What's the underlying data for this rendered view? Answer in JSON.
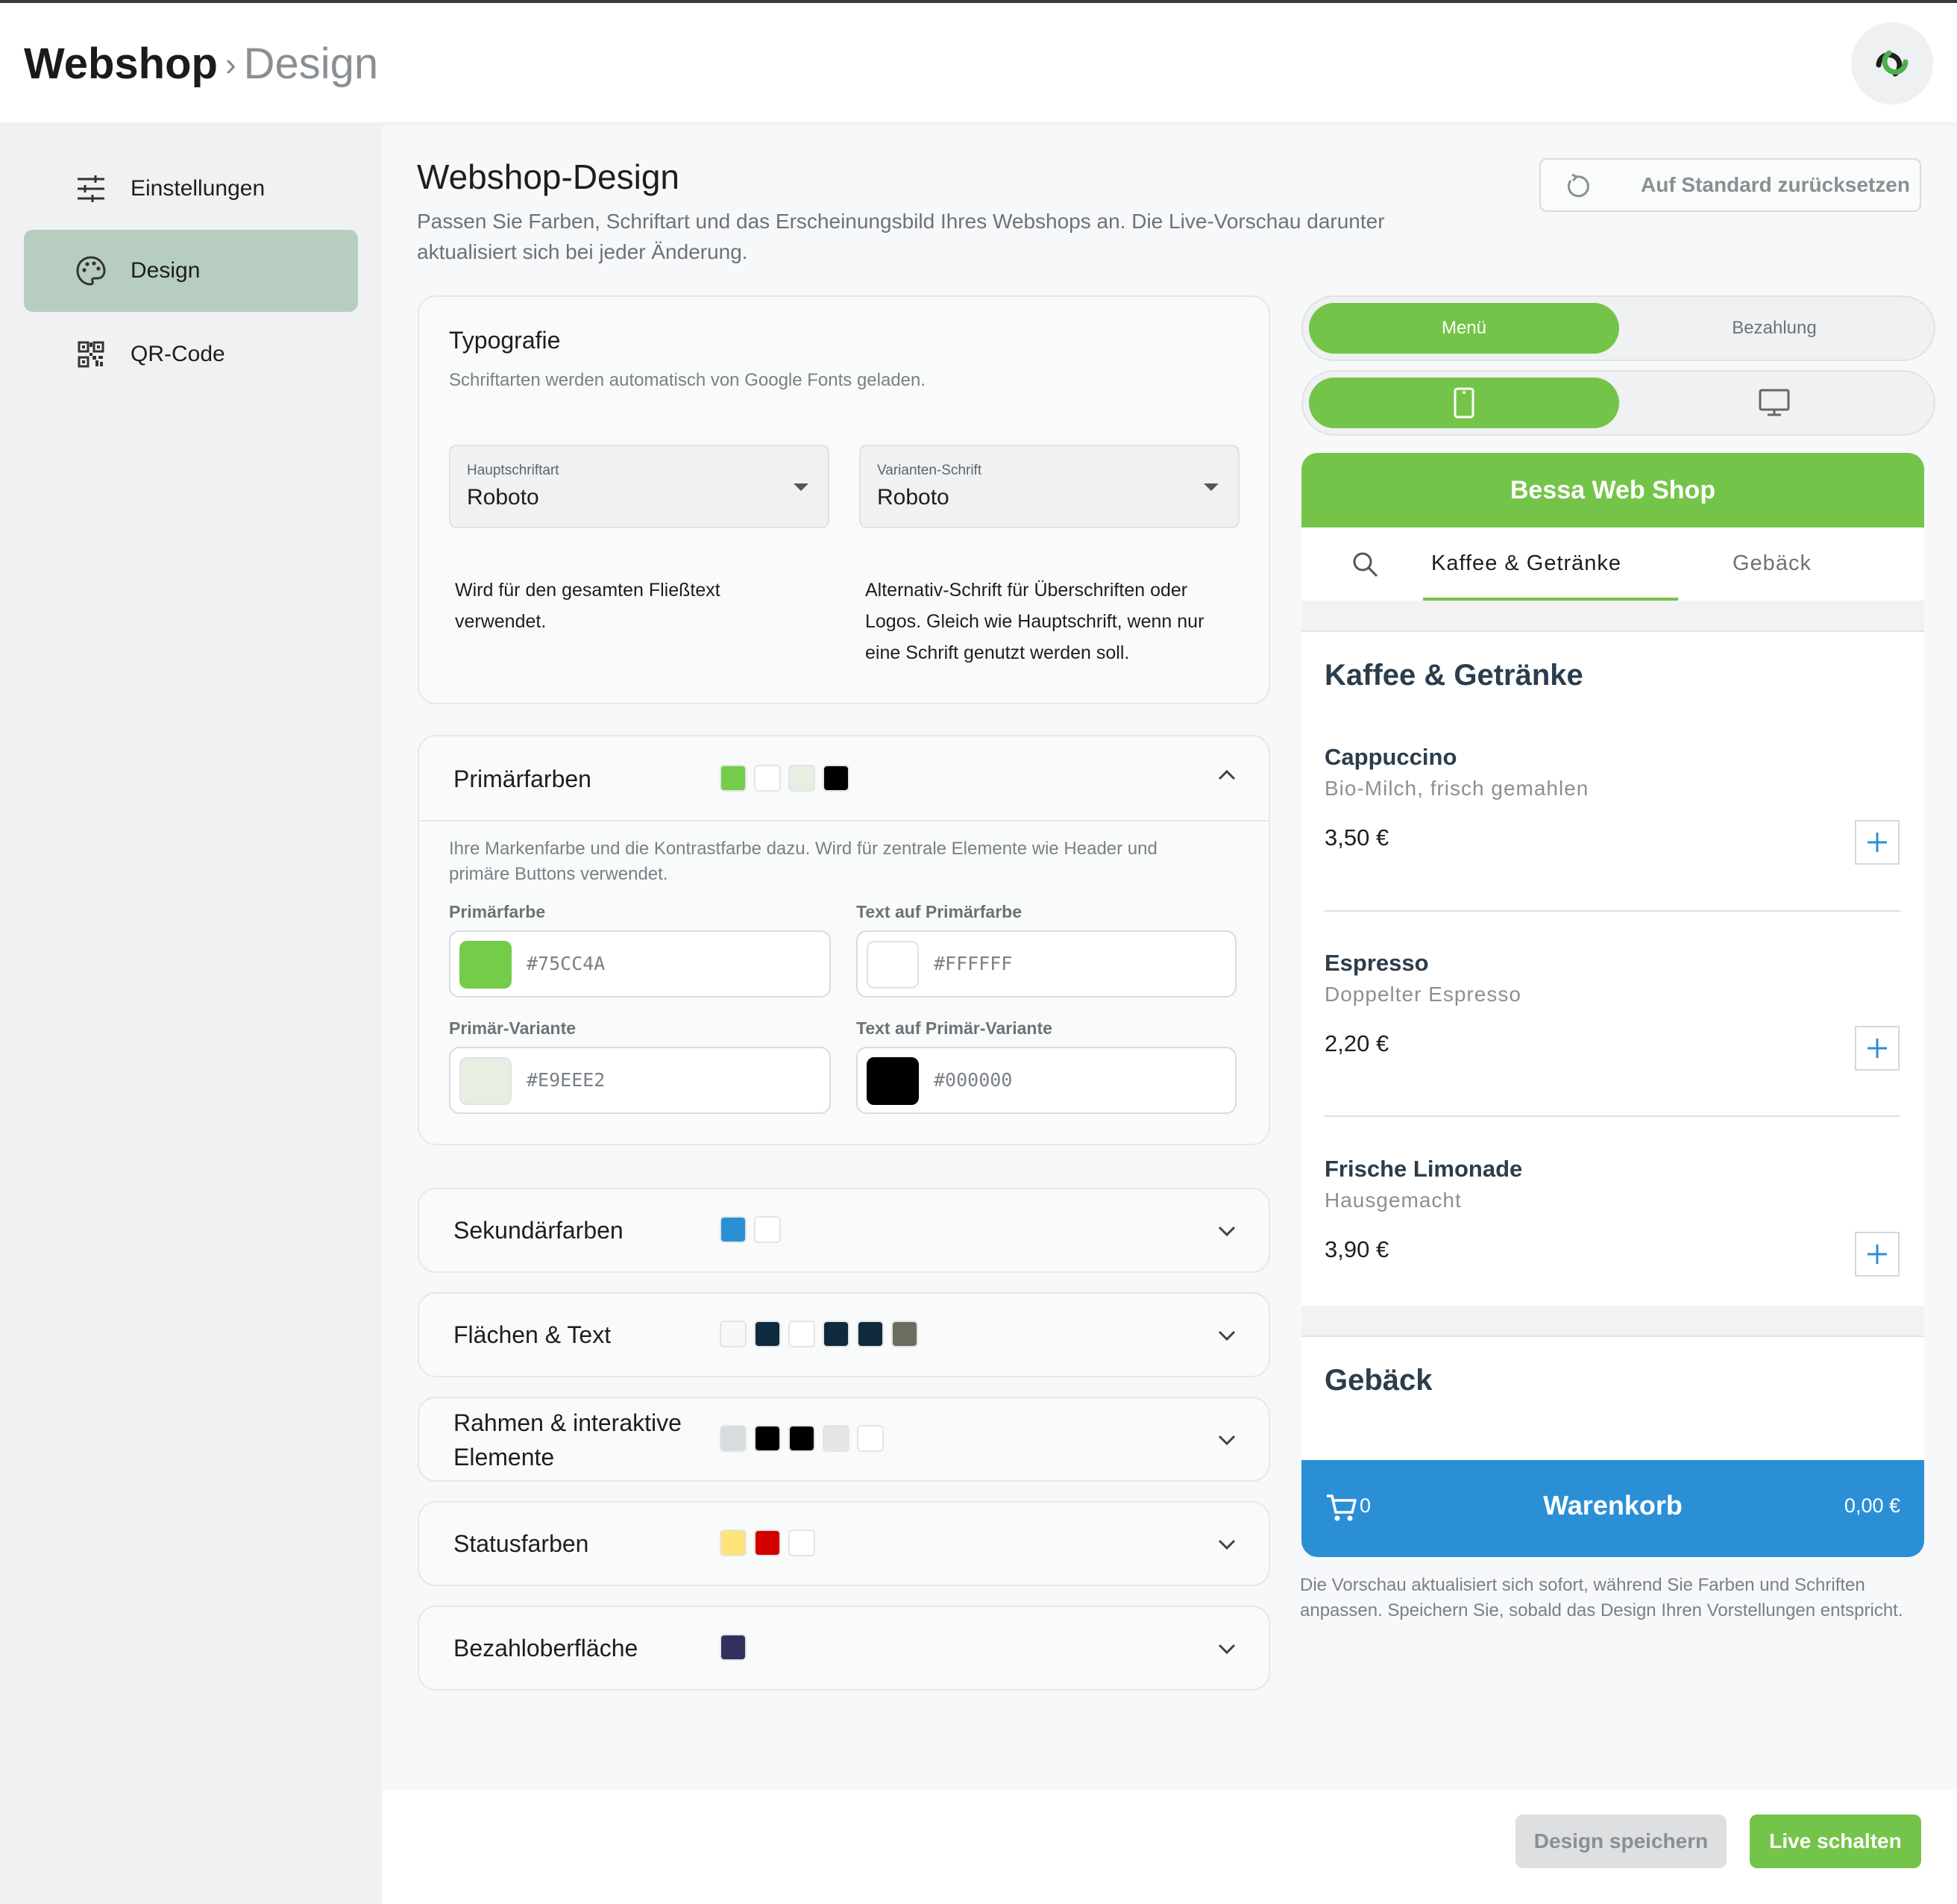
{
  "header": {
    "app_name": "Webshop",
    "separator": "›",
    "section": "Design"
  },
  "sidebar": {
    "items": [
      {
        "label": "Einstellungen",
        "icon": "sliders-icon",
        "active": false
      },
      {
        "label": "Design",
        "icon": "palette-icon",
        "active": true
      },
      {
        "label": "QR-Code",
        "icon": "qr-code-icon",
        "active": false
      }
    ]
  },
  "main": {
    "title": "Webshop-Design",
    "description": "Passen Sie Farben, Schriftart und das Erscheinungsbild Ihres Webshops an. Die Live-Vorschau darunter aktualisiert sich bei jeder Änderung.",
    "reset_label": "Auf Standard zurücksetzen"
  },
  "typography": {
    "title": "Typografie",
    "subtitle": "Schriftarten werden automatisch von Google Fonts geladen.",
    "main_font": {
      "caption": "Hauptschriftart",
      "value": "Roboto",
      "help": "Wird für den gesamten Fließtext verwendet."
    },
    "variant_font": {
      "caption": "Varianten-Schrift",
      "value": "Roboto",
      "help": "Alternativ-Schrift für Überschriften oder Logos. Gleich wie Hauptschrift, wenn nur eine Schrift genutzt werden soll."
    }
  },
  "primary": {
    "title": "Primärfarben",
    "expanded": true,
    "swatches": [
      "#75CC4A",
      "#FFFFFF",
      "#E9EEE2",
      "#000000"
    ],
    "description": "Ihre Markenfarbe und die Kontrastfarbe dazu. Wird für zentrale Elemente wie Header und primäre Buttons verwendet.",
    "fields": [
      {
        "label": "Primärfarbe",
        "value": "#75CC4A"
      },
      {
        "label": "Text auf Primärfarbe",
        "value": "#FFFFFF"
      },
      {
        "label": "Primär-Variante",
        "value": "#E9EEE2"
      },
      {
        "label": "Text auf Primär-Variante",
        "value": "#000000"
      }
    ]
  },
  "sections": [
    {
      "title": "Sekundärfarben",
      "swatches": [
        "#2B8FD6",
        "#FFFFFF"
      ]
    },
    {
      "title": "Flächen & Text",
      "swatches": [
        "#F7F8F9",
        "#0F2A3D",
        "#FFFFFF",
        "#0F2A3D",
        "#0F2A3D",
        "#6B6E5E"
      ]
    },
    {
      "title": "Rahmen & interaktive Elemente",
      "swatches": [
        "#D9DCDE",
        "#000000",
        "#000000",
        "#E3E5E7",
        "#FFFFFF"
      ]
    },
    {
      "title": "Statusfarben",
      "swatches": [
        "#FFE27A",
        "#D40000",
        "#FFFFFF"
      ]
    },
    {
      "title": "Bezahloberfläche",
      "swatches": [
        "#34305E"
      ]
    }
  ],
  "preview": {
    "mode_tabs": [
      "Menü",
      "Bezahlung"
    ],
    "device_icons": [
      "phone-icon",
      "monitor-icon"
    ],
    "shop_name": "Bessa Web Shop",
    "category_tabs": [
      "Kaffee & Getränke",
      "Gebäck"
    ],
    "categories": [
      {
        "name": "Kaffee & Getränke",
        "items": [
          {
            "name": "Cappuccino",
            "desc": "Bio-Milch, frisch gemahlen",
            "price": "3,50 €"
          },
          {
            "name": "Espresso",
            "desc": "Doppelter Espresso",
            "price": "2,20 €"
          },
          {
            "name": "Frische Limonade",
            "desc": "Hausgemacht",
            "price": "3,90 €"
          }
        ]
      },
      {
        "name": "Gebäck"
      }
    ],
    "cart": {
      "count": "0",
      "label": "Warenkorb",
      "total": "0,00 €"
    },
    "note": "Die Vorschau aktualisiert sich sofort, während Sie Farben und Schriften anpassen. Speichern Sie, sobald das Design Ihren Vorstellungen entspricht."
  },
  "footer": {
    "save_label": "Design speichern",
    "publish_label": "Live schalten"
  },
  "colors": {
    "accent": "#75C44A",
    "secondary": "#2B8FD6",
    "active_nav": "#B6CDBF"
  }
}
